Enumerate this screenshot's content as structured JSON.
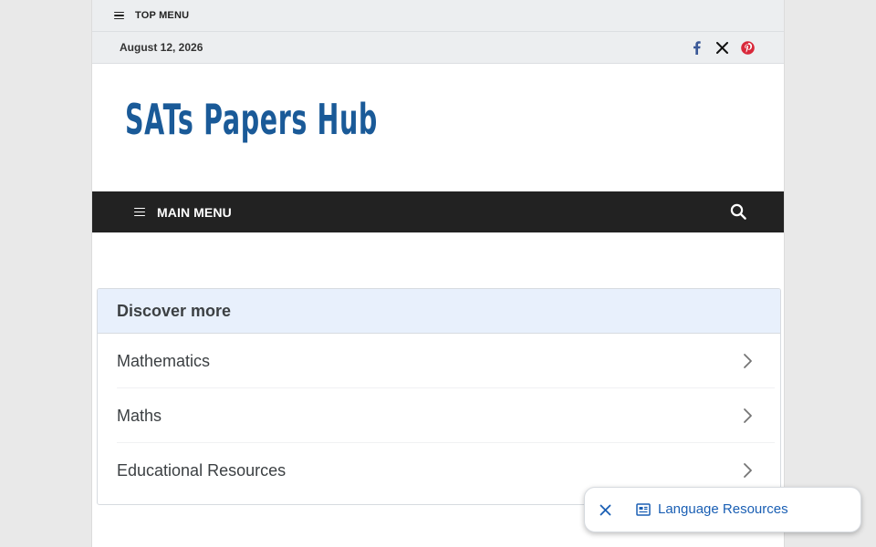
{
  "top_menu": {
    "label": "TOP MENU"
  },
  "date_bar": {
    "date": "August 12, 2026",
    "socials": [
      {
        "icon": "facebook-icon",
        "color": "#3b5998"
      },
      {
        "icon": "x-icon",
        "color": "#111111"
      },
      {
        "icon": "pinterest-icon",
        "color": "#d9283a"
      }
    ]
  },
  "header": {
    "logo_text": "SATs Papers Hub",
    "logo_color": "#1a5a98"
  },
  "main_menu": {
    "label": "MAIN MENU",
    "search_icon": "search-icon"
  },
  "discover": {
    "title": "Discover more",
    "items": [
      {
        "label": "Mathematics"
      },
      {
        "label": "Maths"
      },
      {
        "label": "Educational Resources"
      }
    ]
  },
  "floating_pill": {
    "label": "Language Resources",
    "close_icon": "close-icon",
    "icon": "newspaper-icon",
    "color": "#1a5fb4"
  }
}
